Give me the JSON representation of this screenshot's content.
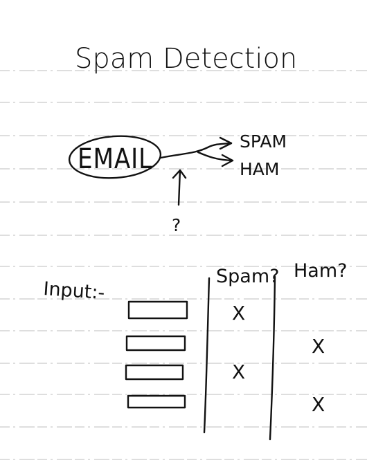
{
  "title": "Spam Detection",
  "email_label": "EMAIL",
  "outputs": {
    "spam": "SPAM",
    "ham": "HAM"
  },
  "unknown_marker": "?",
  "input_label": "Input:-",
  "columns": {
    "spam": "Spam?",
    "ham": "Ham?"
  },
  "rows": [
    {
      "mark": "X",
      "column": "spam"
    },
    {
      "mark": "X",
      "column": "ham"
    },
    {
      "mark": "X",
      "column": "spam"
    },
    {
      "mark": "X",
      "column": "ham"
    }
  ]
}
